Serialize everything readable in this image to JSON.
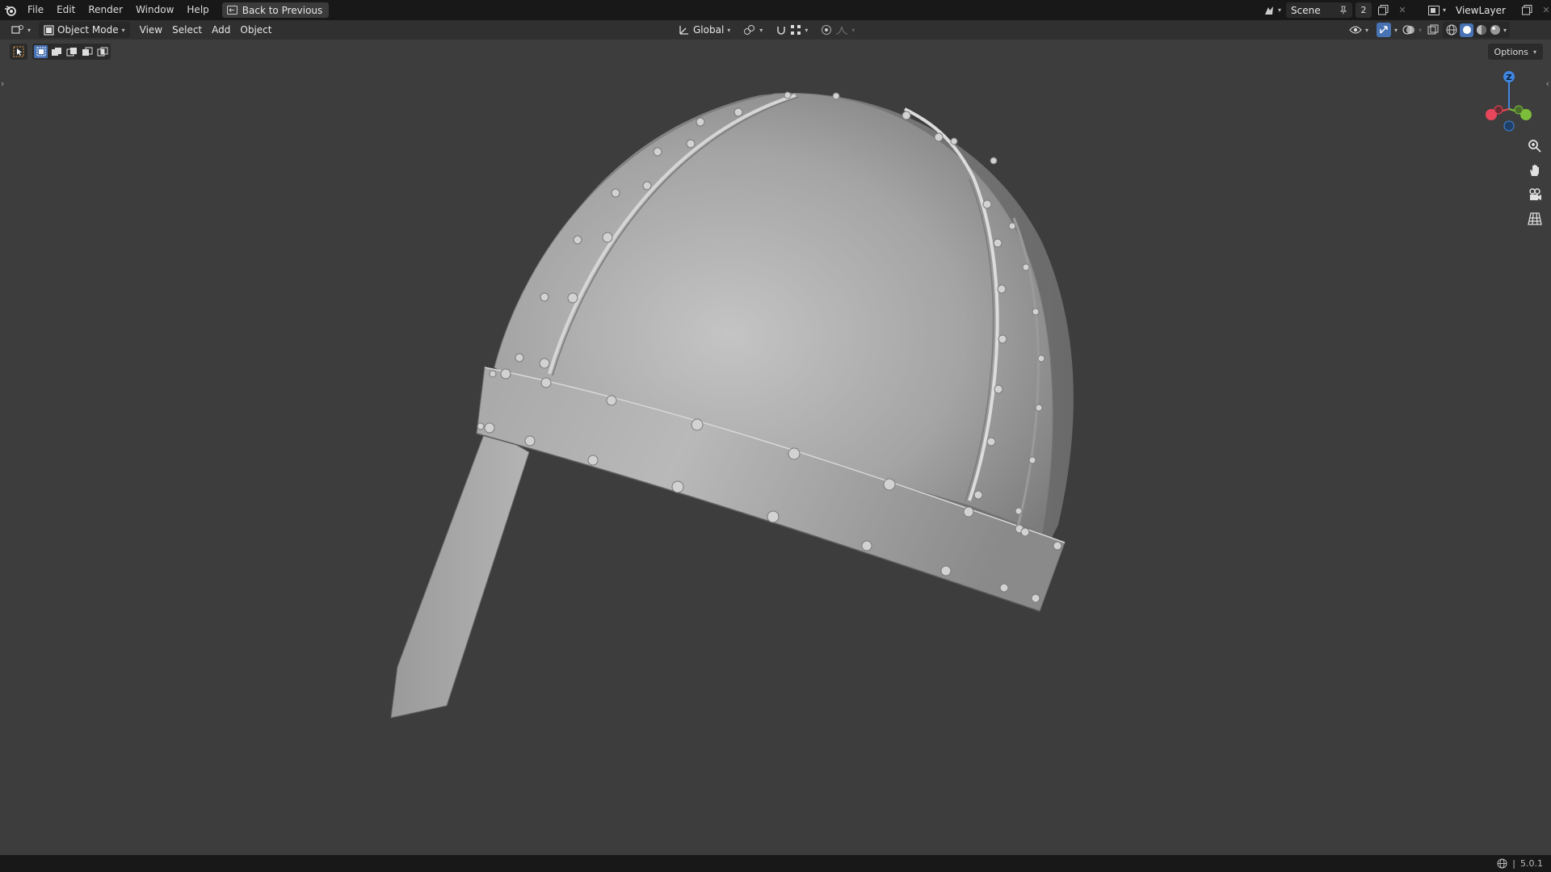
{
  "menubar": {
    "items": [
      "File",
      "Edit",
      "Render",
      "Window",
      "Help"
    ],
    "back_button": "Back to Previous",
    "scene_name": "Scene",
    "scene_users": "2",
    "view_layer": "ViewLayer"
  },
  "viewport_header": {
    "mode": "Object Mode",
    "menus": [
      "View",
      "Select",
      "Add",
      "Object"
    ],
    "orientation": "Global"
  },
  "viewport": {
    "options_label": "Options",
    "gizmo_axis_z": "Z"
  },
  "status": {
    "version": "5.0.1"
  },
  "colors": {
    "accent": "#4772b3",
    "viewport_bg": "#3d3d3d",
    "axis_x": "#e8475b",
    "axis_y": "#7cbd3a",
    "axis_z": "#3f86e0"
  },
  "icons": [
    "blender-logo",
    "editor-type-icon",
    "object-mode-icon",
    "orientation-icon",
    "pivot-icon",
    "snap-icon",
    "proportional-icon",
    "visibility-icon",
    "gizmo-icon",
    "overlay-icon",
    "xray-icon",
    "shading-icons",
    "zoom-icon",
    "hand-icon",
    "camera-icon",
    "grid-icon",
    "globe-icon"
  ]
}
